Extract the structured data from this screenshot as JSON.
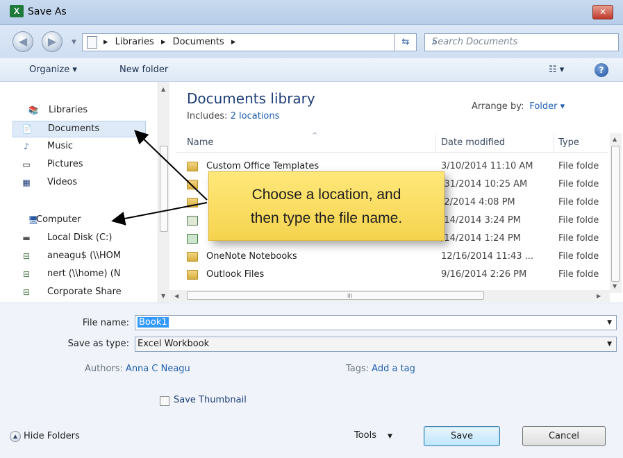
{
  "window": {
    "title": "Save As",
    "close_label": "✕",
    "app_icon_letter": "X"
  },
  "nav": {
    "back_glyph": "◀",
    "forward_glyph": "▶"
  },
  "address": {
    "crumbs": [
      "Libraries",
      "Documents"
    ]
  },
  "search": {
    "placeholder": "Search Documents"
  },
  "toolbar": {
    "organize": "Organize ▾",
    "new_folder": "New folder",
    "view": "☷ ▾",
    "help": "?"
  },
  "sidebar": {
    "items": [
      {
        "label": "Libraries",
        "icon": "libraries-icon",
        "glyph": "📚"
      },
      {
        "label": "Documents",
        "icon": "document-icon",
        "glyph": "📄"
      },
      {
        "label": "Music",
        "icon": "music-icon",
        "glyph": "♪"
      },
      {
        "label": "Pictures",
        "icon": "pictures-icon",
        "glyph": "▭"
      },
      {
        "label": "Videos",
        "icon": "videos-icon",
        "glyph": "▦"
      },
      {
        "label": "Computer",
        "icon": "computer-icon",
        "glyph": "🖥"
      },
      {
        "label": "Local Disk (C:)",
        "icon": "disk-icon",
        "glyph": "▬"
      },
      {
        "label": "aneagu$ (\\\\HOM",
        "icon": "network-drive-icon",
        "glyph": "⊟"
      },
      {
        "label": "nert (\\\\home) (N",
        "icon": "network-drive-icon",
        "glyph": "⊟"
      },
      {
        "label": "Corporate Share",
        "icon": "network-drive-icon",
        "glyph": "⊟"
      }
    ]
  },
  "library": {
    "title": "Documents library",
    "includes_label": "Includes:",
    "includes_link": "2 locations",
    "arrange_label": "Arrange by:",
    "arrange_value": "Folder ▾"
  },
  "columns": {
    "name": "Name",
    "date": "Date modified",
    "type": "Type"
  },
  "files": [
    {
      "name": "Custom Office Templates",
      "date": "3/10/2014 11:10 AM",
      "type": "File folde"
    },
    {
      "name": "",
      "date": "/31/2014 10:25 AM",
      "type": "File folde"
    },
    {
      "name": "",
      "date": "/2/2014 4:08 PM",
      "type": "File folde"
    },
    {
      "name": "",
      "date": "/14/2014 3:24 PM",
      "type": "File folde"
    },
    {
      "name": "",
      "date": "/14/2014 1:24 PM",
      "type": "File folde"
    },
    {
      "name": "OneNote Notebooks",
      "date": "12/16/2014 11:43 ...",
      "type": "File folde"
    },
    {
      "name": "Outlook Files",
      "date": "9/16/2014 2:26 PM",
      "type": "File folde"
    }
  ],
  "callout": {
    "line1": "Choose a location, and",
    "line2": "then type the file name."
  },
  "form": {
    "filename_label": "File name:",
    "filename_value": "Book1",
    "savetype_label": "Save as type:",
    "savetype_value": "Excel Workbook",
    "authors_label": "Authors:",
    "authors_value": "Anna C Neagu",
    "tags_label": "Tags:",
    "tags_value": "Add a tag",
    "thumbnail_label": "Save Thumbnail"
  },
  "footer": {
    "hide_folders": "Hide Folders",
    "tools": "Tools",
    "save": "Save",
    "cancel": "Cancel"
  }
}
